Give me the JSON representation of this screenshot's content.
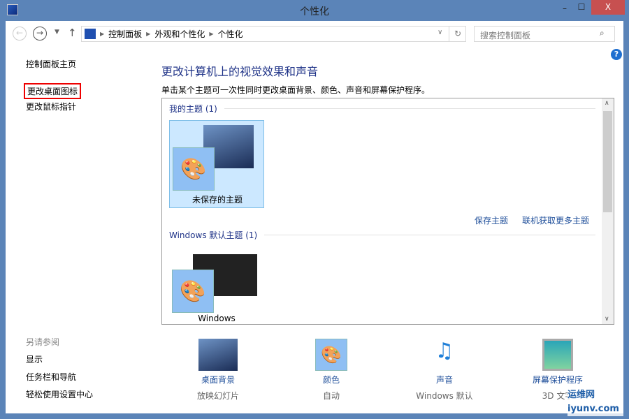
{
  "window": {
    "title": "个性化"
  },
  "controls": {
    "minimize": "–",
    "maximize": "☐",
    "close": "X"
  },
  "address": {
    "segments": [
      "控制面板",
      "外观和个性化",
      "个性化"
    ]
  },
  "search": {
    "placeholder": "搜索控制面板"
  },
  "sidebar": {
    "home": "控制面板主页",
    "links": [
      "更改桌面图标",
      "更改鼠标指针"
    ],
    "see_also_title": "另请参阅",
    "see_also": [
      "显示",
      "任务栏和导航",
      "轻松使用设置中心"
    ]
  },
  "main": {
    "heading": "更改计算机上的视觉效果和声音",
    "description": "单击某个主题可一次性同时更改桌面背景、颜色、声音和屏幕保护程序。",
    "my_themes": {
      "title": "我的主题 (1)",
      "items": [
        "未保存的主题"
      ]
    },
    "actions": [
      "保存主题",
      "联机获取更多主题"
    ],
    "default_themes": {
      "title": "Windows 默认主题 (1)",
      "items": [
        "Windows"
      ]
    }
  },
  "bottom": [
    {
      "label": "桌面背景",
      "sub": "放映幻灯片"
    },
    {
      "label": "颜色",
      "sub": "自动"
    },
    {
      "label": "声音",
      "sub": "Windows 默认"
    },
    {
      "label": "屏幕保护程序",
      "sub": "3D 文字"
    }
  ],
  "watermark": "运维网 iyunv.com"
}
